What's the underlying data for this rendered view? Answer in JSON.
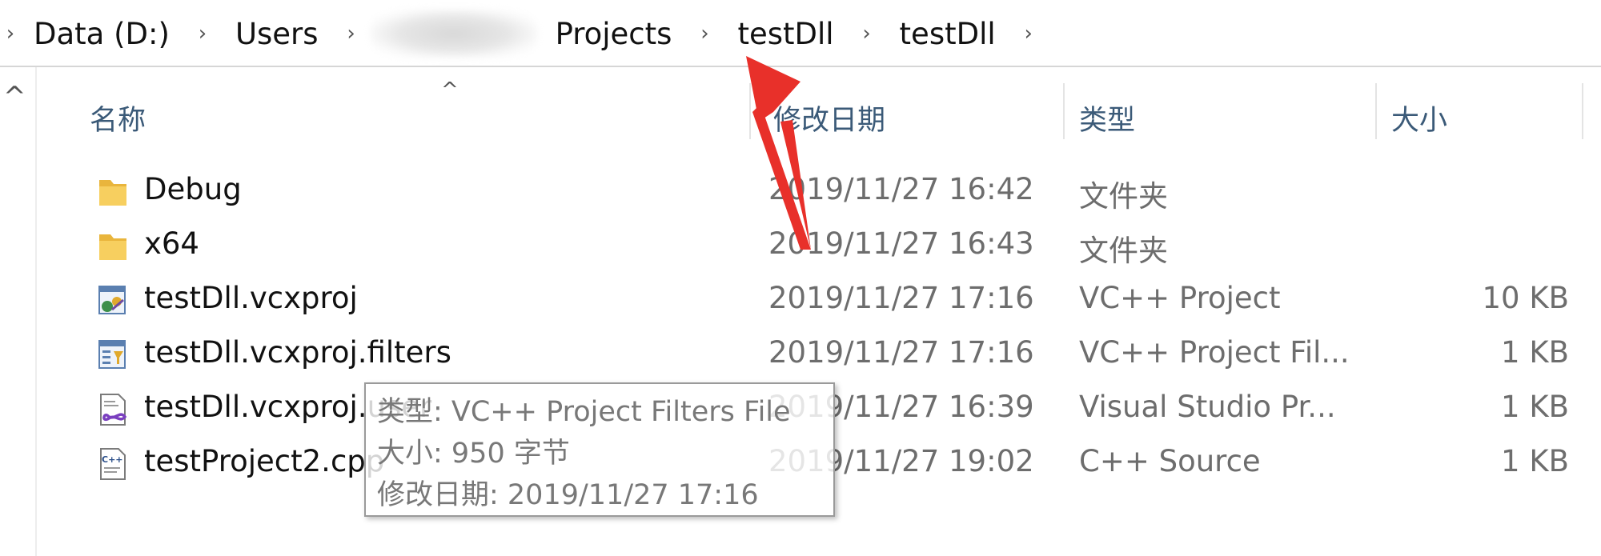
{
  "address": {
    "crumbs": [
      "Data (D:)",
      "Users",
      "Projects",
      "testDll",
      "testDll"
    ]
  },
  "nav": {
    "up_glyph": "^"
  },
  "columns": {
    "name": "名称",
    "date": "修改日期",
    "type": "类型",
    "size": "大小",
    "sort_glyph": "^"
  },
  "files": [
    {
      "name": "Debug",
      "date": "2019/11/27 16:42",
      "type": "文件夹",
      "size": "",
      "icon": "folder-icon"
    },
    {
      "name": "x64",
      "date": "2019/11/27 16:43",
      "type": "文件夹",
      "size": "",
      "icon": "folder-icon"
    },
    {
      "name": "testDll.vcxproj",
      "date": "2019/11/27 17:16",
      "type": "VC++ Project",
      "size": "10 KB",
      "icon": "vcxproj-icon"
    },
    {
      "name": "testDll.vcxproj.filters",
      "date": "2019/11/27 17:16",
      "type": "VC++ Project Fil...",
      "size": "1 KB",
      "icon": "filters-icon"
    },
    {
      "name": "testDll.vcxproj.user",
      "date": "2019/11/27 16:39",
      "type": "Visual Studio Pr...",
      "size": "1 KB",
      "icon": "visual-studio-icon"
    },
    {
      "name": "testProject2.cpp",
      "date": "2019/11/27 19:02",
      "type": "C++ Source",
      "size": "1 KB",
      "icon": "cpp-file-icon"
    }
  ],
  "tooltip": {
    "type_line": "类型: VC++ Project Filters File",
    "size_line": "大小: 950 字节",
    "date_line": "修改日期: 2019/11/27 17:16"
  },
  "colors": {
    "header_text": "#3b5a78",
    "annotation_arrow": "#e8302a",
    "folder": "#f4c44e"
  }
}
